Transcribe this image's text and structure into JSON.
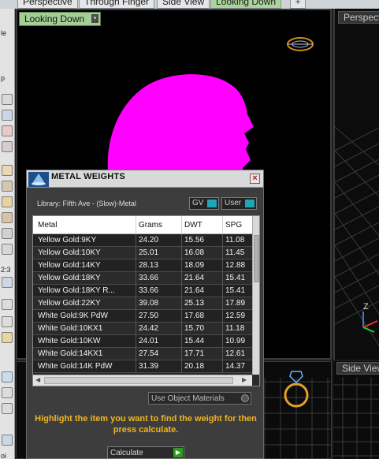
{
  "tabs": [
    {
      "label": "Perspective",
      "active": false
    },
    {
      "label": "Through Finger",
      "active": false
    },
    {
      "label": "Side View",
      "active": false
    },
    {
      "label": "Looking Down",
      "active": true
    }
  ],
  "tab_add_symbol": "+",
  "left_toolbar_texts": [
    "le",
    "p",
    "2:3",
    "oi"
  ],
  "viewports": {
    "main_title": "Looking Down",
    "main_dropdown_symbol": "▾",
    "right_title": "Perspective",
    "bottom_right_title": "Side View",
    "axis_label": "Z"
  },
  "metal_weights": {
    "title": "METAL WEIGHTS",
    "close_symbol": "×",
    "library": "Library: Fifth Ave - (Slow)-Metal",
    "toggle_gv": "GV",
    "toggle_user": "User",
    "columns": [
      "Metal",
      "Grams",
      "DWT",
      "SPG"
    ],
    "rows": [
      [
        "Yellow Gold:9KY",
        "24.20",
        "15.56",
        "11.08"
      ],
      [
        "Yellow Gold:10KY",
        "25.01",
        "16.08",
        "11.45"
      ],
      [
        "Yellow Gold:14KY",
        "28.13",
        "18.09",
        "12.88"
      ],
      [
        "Yellow Gold:18KY",
        "33.66",
        "21.64",
        "15.41"
      ],
      [
        "Yellow Gold:18KY R...",
        "33.66",
        "21.64",
        "15.41"
      ],
      [
        "Yellow Gold:22KY",
        "39.08",
        "25.13",
        "17.89"
      ],
      [
        "White Gold:9K PdW",
        "27.50",
        "17.68",
        "12.59"
      ],
      [
        "White Gold:10KX1",
        "24.42",
        "15.70",
        "11.18"
      ],
      [
        "White Gold:10KW",
        "24.01",
        "15.44",
        "10.99"
      ],
      [
        "White Gold:14KX1",
        "27.54",
        "17.71",
        "12.61"
      ],
      [
        "White Gold:14K PdW",
        "31.39",
        "20.18",
        "14.37"
      ]
    ],
    "use_object_materials": "Use Object Materials",
    "instructions": "Highlight the item you want to find the weight for then press calculate.",
    "calculate_label": "Calculate",
    "calculate_icon": "▶"
  },
  "colors": {
    "head_model": "#ff00ff",
    "active_tab": "#a9d49a",
    "instruction_text": "#f1b51f",
    "toggle_on": "#1fa5b6",
    "calculate_play": "#2c9b22"
  }
}
